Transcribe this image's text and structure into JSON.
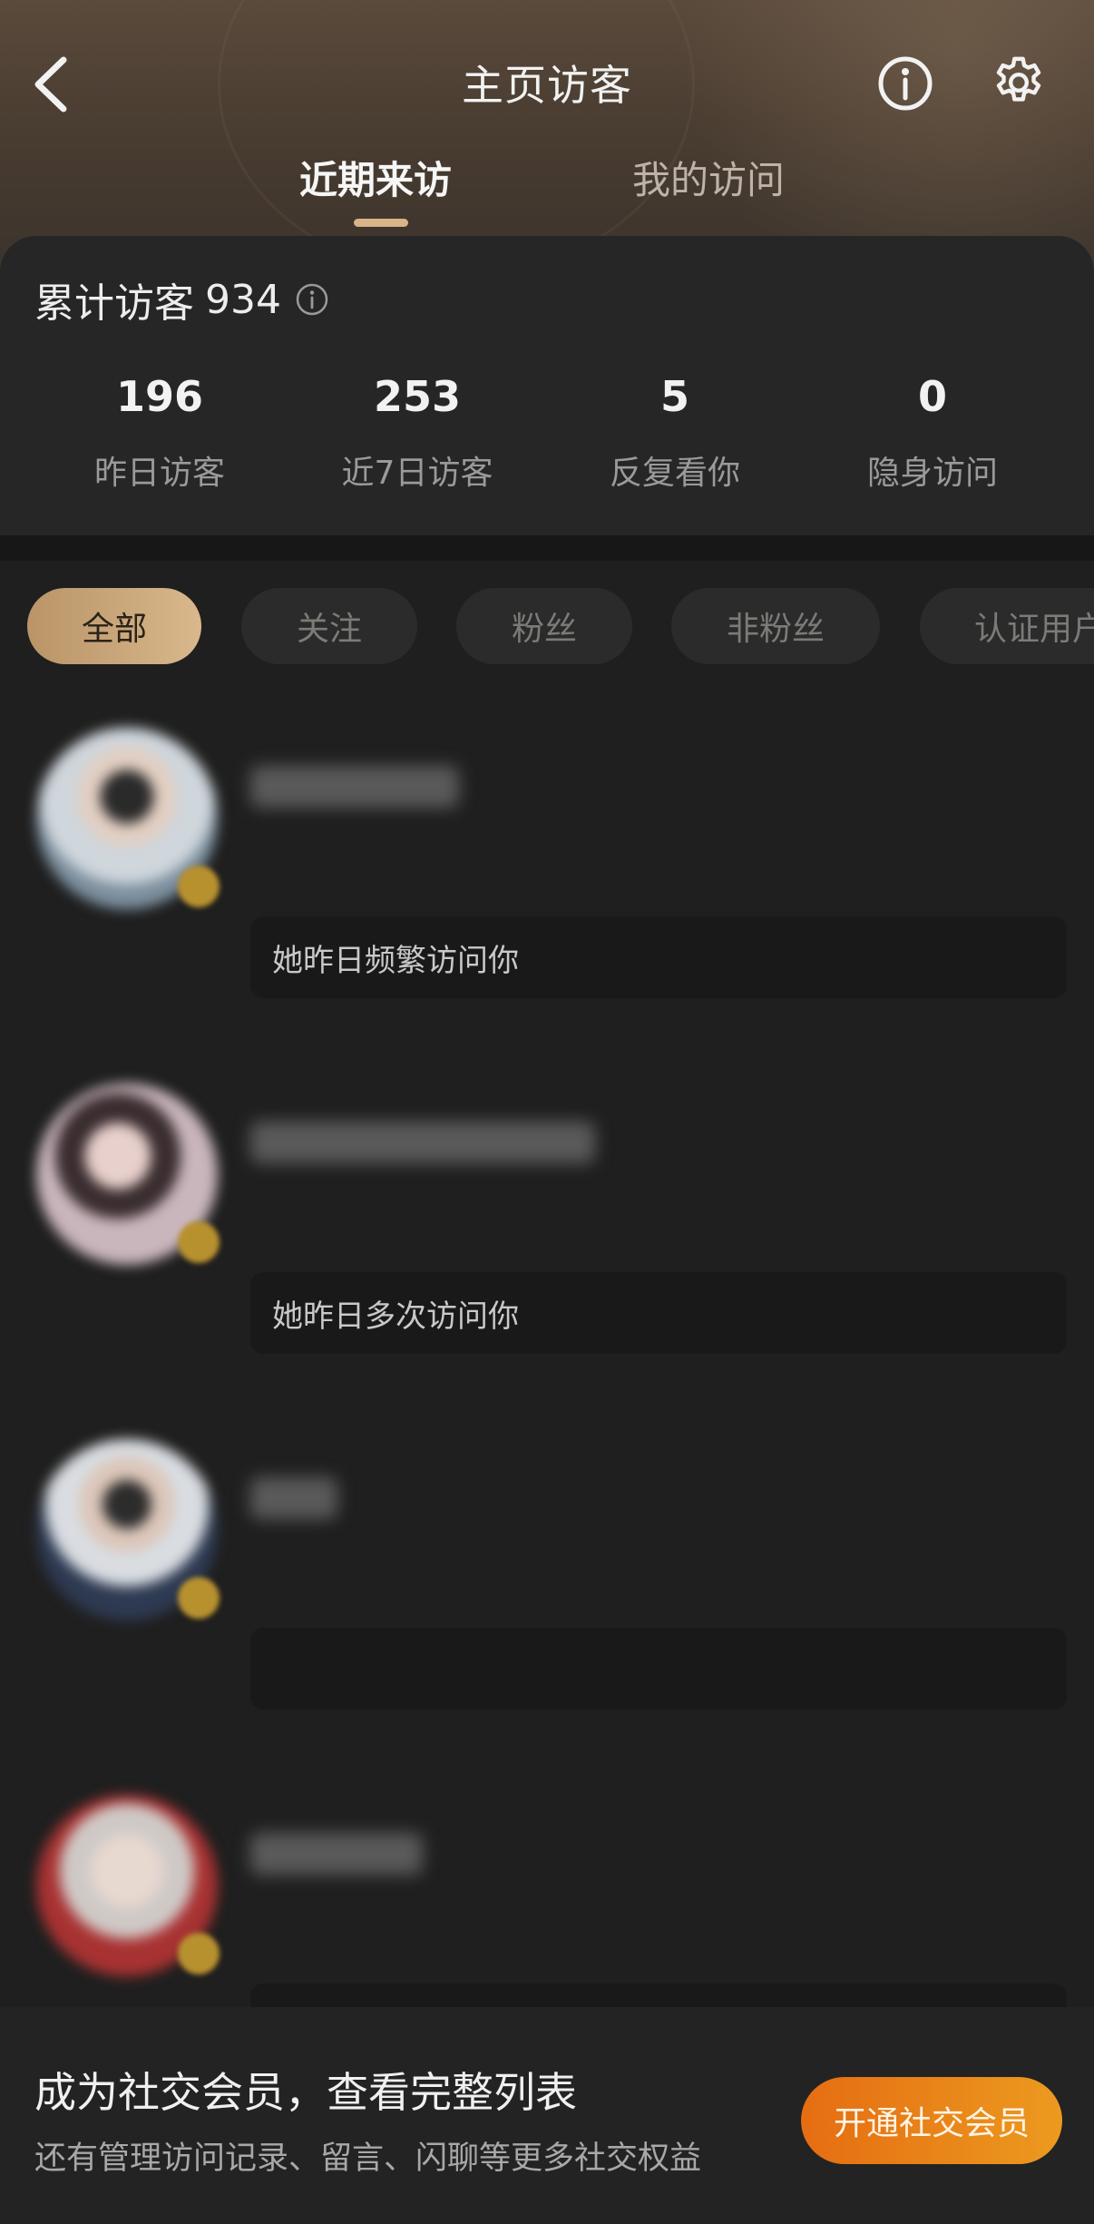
{
  "header": {
    "title": "主页访客",
    "back_icon": "chevron-left-icon",
    "info_icon": "info-circle-icon",
    "settings_icon": "gear-icon"
  },
  "tabs": [
    {
      "label": "近期来访",
      "active": true
    },
    {
      "label": "我的访问",
      "active": false
    }
  ],
  "summary": {
    "total_label": "累计访客",
    "total_value": "934",
    "info_icon": "info-circle-icon"
  },
  "stats": [
    {
      "value": "196",
      "label": "昨日访客"
    },
    {
      "value": "253",
      "label": "近7日访客"
    },
    {
      "value": "5",
      "label": "反复看你"
    },
    {
      "value": "0",
      "label": "隐身访问"
    }
  ],
  "filters": [
    {
      "label": "全部",
      "active": true
    },
    {
      "label": "关注",
      "active": false
    },
    {
      "label": "粉丝",
      "active": false
    },
    {
      "label": "非粉丝",
      "active": false
    },
    {
      "label": "认证用户",
      "active": false
    }
  ],
  "visitors": [
    {
      "note": "她昨日频繁访问你",
      "note_blurred": false,
      "avatar_color": "#8a9aa8"
    },
    {
      "note": "她昨日多次访问你",
      "note_blurred": false,
      "avatar_color": "#b5a0a8"
    },
    {
      "note": "",
      "note_blurred": true,
      "avatar_color": "#7e8896"
    },
    {
      "note": "",
      "note_blurred": true,
      "avatar_color": "#a83a3a"
    }
  ],
  "promo": {
    "title": "成为社交会员，查看完整列表",
    "subtitle": "还有管理访问记录、留言、闪聊等更多社交权益",
    "button_label": "开通社交会员"
  },
  "colors": {
    "accent_gold": "#d8b488",
    "promo_orange": "#e56d12",
    "background": "#1f1f1f"
  }
}
